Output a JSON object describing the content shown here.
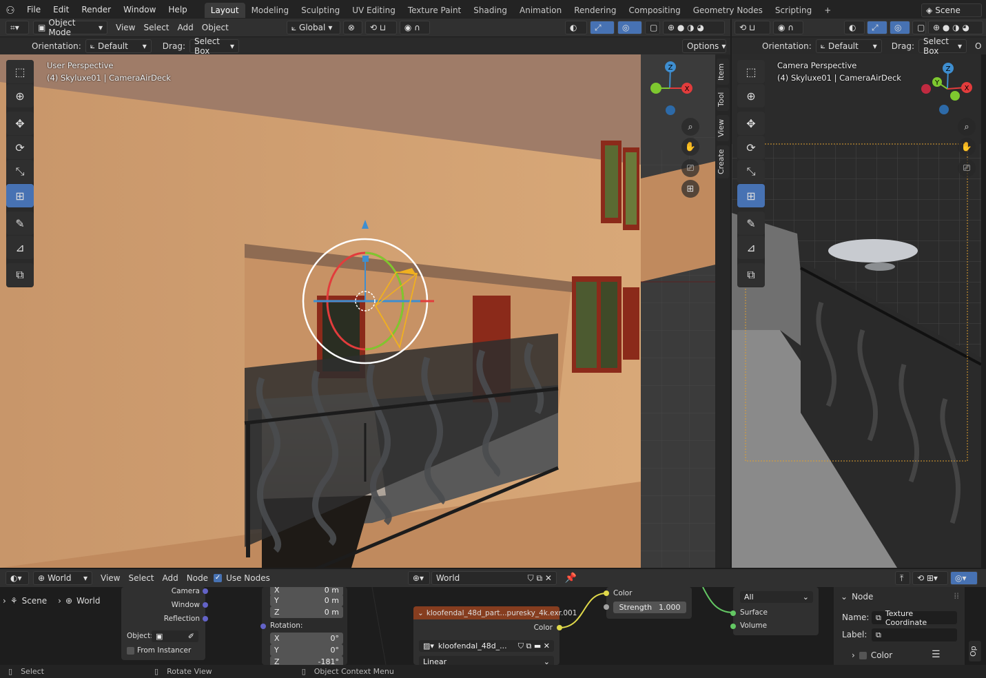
{
  "topbar": {
    "menus": [
      "File",
      "Edit",
      "Render",
      "Window",
      "Help"
    ],
    "workspaces": [
      "Layout",
      "Modeling",
      "Sculpting",
      "UV Editing",
      "Texture Paint",
      "Shading",
      "Animation",
      "Rendering",
      "Compositing",
      "Geometry Nodes",
      "Scripting"
    ],
    "add": "+",
    "scene": "Scene"
  },
  "vp_header": {
    "mode": "Object Mode",
    "menus": [
      "View",
      "Select",
      "Add",
      "Object"
    ],
    "transform": "Global"
  },
  "tool_header": {
    "orientation_label": "Orientation:",
    "orientation_value": "Default",
    "drag_label": "Drag:",
    "drag_value": "Select Box",
    "options": "Options"
  },
  "left_vp": {
    "line1": "User Perspective",
    "line2": "(4) Skyluxe01 | CameraAirDeck",
    "tabs": [
      "Item",
      "Tool",
      "View",
      "Create"
    ]
  },
  "right_vp": {
    "line1": "Camera Perspective",
    "line2": "(4) Skyluxe01 | CameraAirDeck",
    "orientation_label": "Orientation:",
    "orientation_value": "Default",
    "drag_label": "Drag:",
    "drag_value": "Select Box",
    "o": "O"
  },
  "gizmo": {
    "x": "X",
    "y": "Y",
    "z": "Z"
  },
  "node_header": {
    "world_type": "World",
    "menus": [
      "View",
      "Select",
      "Node"
    ],
    "use_nodes": "Use Nodes",
    "world_name": "World"
  },
  "breadcrumb": {
    "scene": "Scene",
    "world": "World"
  },
  "node_lightpath": {
    "camera": "Camera",
    "window": "Window",
    "reflection": "Reflection",
    "object": "Object:",
    "from_instancer": "From Instancer"
  },
  "node_mapping": {
    "x_loc": "X",
    "x_loc_v": "0 m",
    "y_loc": "Y",
    "y_loc_v": "0 m",
    "z_loc": "Z",
    "z_loc_v": "0 m",
    "rotation": "Rotation:",
    "rx": "X",
    "rx_v": "0°",
    "ry": "Y",
    "ry_v": "0°",
    "rz": "Z",
    "rz_v": "-181°"
  },
  "node_image": {
    "title": "kloofendal_48d_part...puresky_4k.exr.001",
    "color": "Color",
    "image_name": "kloofendal_48d_...",
    "interp": "Linear"
  },
  "node_background": {
    "color": "Color",
    "strength_label": "Strength",
    "strength_value": "1.000"
  },
  "node_output": {
    "target": "All",
    "surface": "Surface",
    "volume": "Volume"
  },
  "sidebar_node": {
    "panel": "Node",
    "name_label": "Name:",
    "name_value": "Texture Coordinate",
    "label_label": "Label:",
    "color": "Color",
    "tab": "Op"
  },
  "status": {
    "select": "Select",
    "rotate": "Rotate View",
    "context": "Object Context Menu"
  }
}
